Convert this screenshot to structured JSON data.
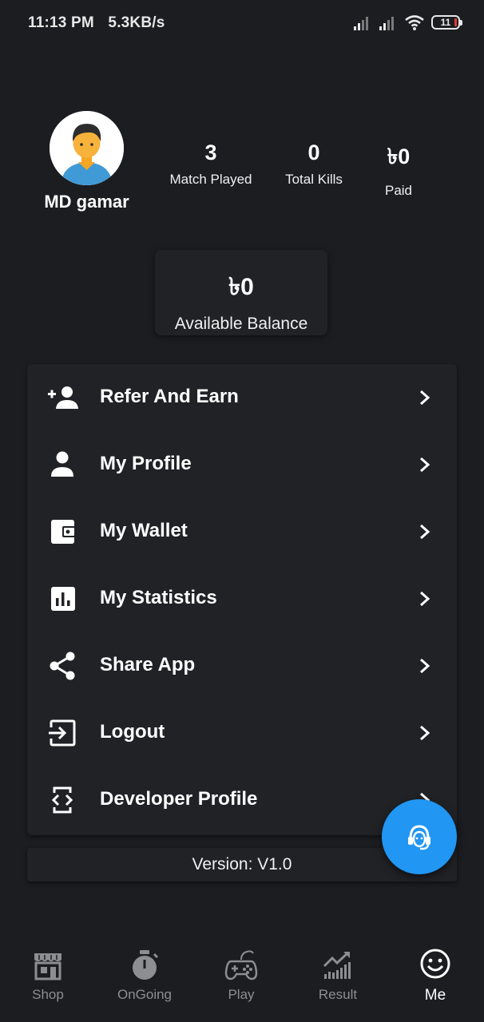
{
  "status_bar": {
    "time": "11:13 PM",
    "speed": "5.3KB/s",
    "battery": "11"
  },
  "profile": {
    "username": "MD gamar",
    "stats": [
      {
        "value": "3",
        "label": "Match Played"
      },
      {
        "value": "0",
        "label": "Total Kills"
      },
      {
        "value": "৳0",
        "label": "Paid"
      }
    ]
  },
  "balance": {
    "amount": "৳0",
    "label": "Available Balance"
  },
  "menu": [
    {
      "label": "Refer And Earn",
      "icon": "person-add-icon"
    },
    {
      "label": "My Profile",
      "icon": "person-icon"
    },
    {
      "label": "My Wallet",
      "icon": "wallet-icon"
    },
    {
      "label": "My Statistics",
      "icon": "statistics-icon"
    },
    {
      "label": "Share App",
      "icon": "share-icon"
    },
    {
      "label": "Logout",
      "icon": "logout-icon"
    },
    {
      "label": "Developer Profile",
      "icon": "developer-icon"
    }
  ],
  "version": "Version: V1.0",
  "fab_icon": "support-agent-icon",
  "bottom_nav": [
    {
      "label": "Shop",
      "icon": "shop-icon"
    },
    {
      "label": "OnGoing",
      "icon": "stopwatch-icon"
    },
    {
      "label": "Play",
      "icon": "gamepad-icon"
    },
    {
      "label": "Result",
      "icon": "chart-trend-icon"
    },
    {
      "label": "Me",
      "icon": "smiley-icon",
      "active": true
    }
  ],
  "colors": {
    "background": "#1c1d21",
    "card": "#212226",
    "accent": "#2196f3",
    "nav_inactive": "#8d8e92"
  }
}
